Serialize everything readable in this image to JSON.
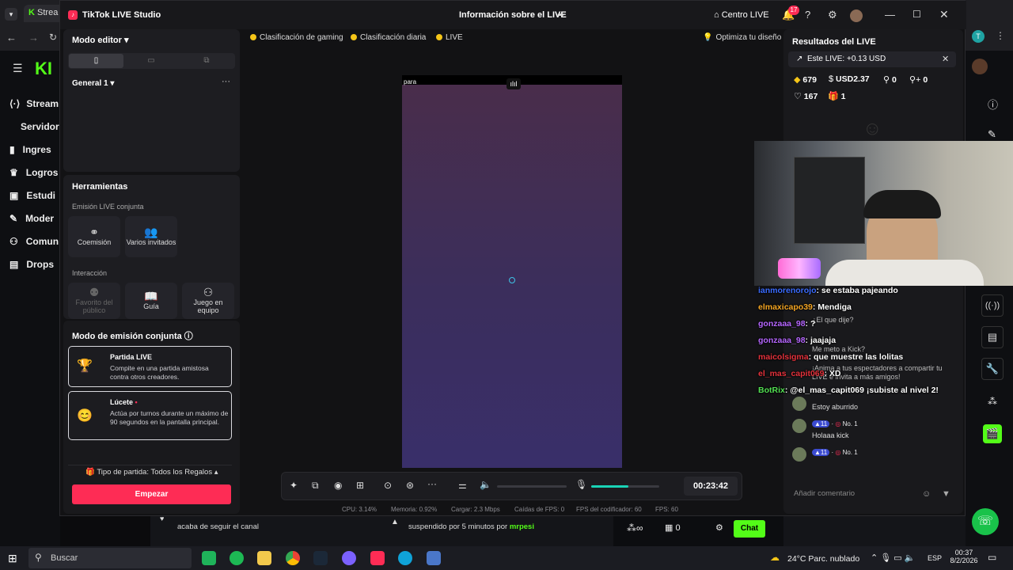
{
  "browser": {
    "tab_label": "Strea",
    "tab_count": "17"
  },
  "kick_sidebar": {
    "items": [
      "Stream",
      "Servidor",
      "Ingres",
      "Logros",
      "Estudi",
      "Moder",
      "Comun",
      "Drops"
    ]
  },
  "window": {
    "app_title": "TikTok LIVE Studio",
    "center_title": "Información sobre el LIVE",
    "centro_live": "Centro LIVE",
    "notif_count": "17"
  },
  "left_panel": {
    "mode_editor": "Modo editor",
    "general": "General 1",
    "tools_title": "Herramientas",
    "joint_title": "Emisión LIVE conjunta",
    "coemision": "Coemisión",
    "varios": "Varios invitados",
    "interaccion": "Interacción",
    "favorito": "Favorito del público",
    "guia": "Guía",
    "juego": "Juego en equipo",
    "modo_joint": "Modo de emisión conjunta",
    "partida_title": "Partida LIVE",
    "partida_desc": "Compite en una partida amistosa contra otros creadores.",
    "lucete_title": "Lúcete",
    "lucete_desc": "Actúa por turnos durante un máximo de 90 segundos en la pantalla principal.",
    "tipo": "Tipo de partida: Todos los Regalos",
    "empezar": "Empezar"
  },
  "top_chips": {
    "gaming": "Clasificación de gaming",
    "diaria": "Clasificación diaria",
    "live": "LIVE",
    "optimiza": "Optimiza tu diseño"
  },
  "preview": {
    "label": "para"
  },
  "controls": {
    "timer": "00:23:42",
    "volume_level": 0.55
  },
  "stats": {
    "cpu": "CPU: 3.14%",
    "memoria": "Memoria: 0.92%",
    "cargar": "Cargar: 2.3 Mbps",
    "caidas": "Caídas de FPS: 0",
    "fps_cod": "FPS del codificador: 60",
    "fps": "FPS: 60"
  },
  "results": {
    "title": "Resultados del LIVE",
    "earnings": "Este LIVE: +0.13 USD",
    "diamonds": "679",
    "usd": "USD2.37",
    "s1": "0",
    "s2": "0",
    "likes": "167",
    "gifts": "1"
  },
  "tiktok_chat": {
    "faint_lines": [
      "¿El que dije?",
      "Me meto a Kick?",
      "¡Anima a tus espectadores a compartir tu LIVE e invita a más amigos!",
      "Estoy aburrido",
      "Holaaa kick"
    ],
    "badge_level": "11",
    "badge_rank": "No. 1",
    "input_placeholder": "Añadir comentario"
  },
  "kick_chat": [
    {
      "user": "ianmorenorojo",
      "msg": ": se estaba pajeando",
      "color": "#3b6cff"
    },
    {
      "user": "elmaxicapo39",
      "msg": ": Mendiga",
      "color": "#f5a623"
    },
    {
      "user": "gonzaaa_98",
      "msg": ": ?",
      "color": "#b667ff"
    },
    {
      "user": "gonzaaa_98",
      "msg": ": jaajaja",
      "color": "#b667ff"
    },
    {
      "user": "maicolsigma",
      "msg": ": que muestre las lolitas",
      "color": "#e5323c"
    },
    {
      "user": "el_mas_capit069",
      "msg": ": XD",
      "color": "#e5323c"
    },
    {
      "user": "BotRix",
      "msg": ": @el_mas_capit069 ¡subiste al nivel 2!",
      "color": "#52e052"
    }
  ],
  "kick_bottom": {
    "follow_text": "acaba de seguir el canal",
    "suspended_text": "suspendido por 5 minutos por",
    "mod_name": "mrpesi",
    "count1": "0",
    "chat_button": "Chat"
  },
  "taskbar": {
    "search": "Buscar",
    "weather": "24°C  Parc. nublado",
    "lang": "ESP",
    "time": "00:37",
    "date": "8/2/2026"
  },
  "colors": {
    "accent": "#fe2c55",
    "kick_green": "#53fc18"
  }
}
